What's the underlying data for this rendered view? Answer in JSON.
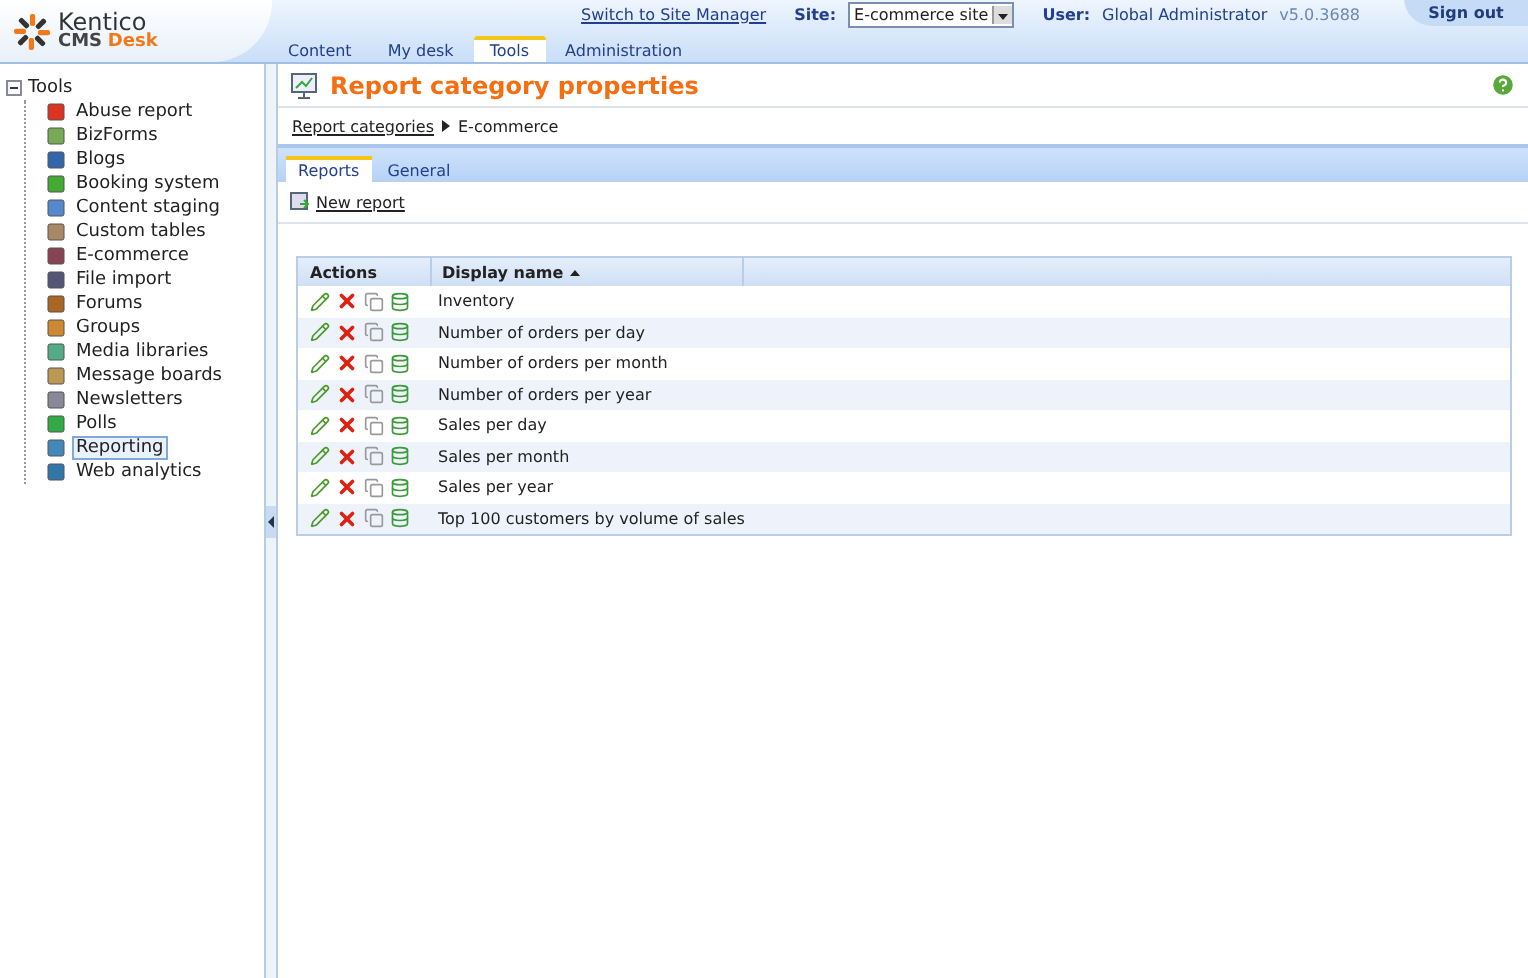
{
  "logo": {
    "name": "Kentico",
    "product": "CMS",
    "edition": "Desk"
  },
  "top_bar": {
    "site_manager_link": "Switch to Site Manager",
    "site_label": "Site:",
    "site_value": "E-commerce site",
    "user_label": "User:",
    "user_name": "Global Administrator",
    "version": "v5.0.3688",
    "sign_out": "Sign out"
  },
  "main_tabs": [
    {
      "label": "Content",
      "selected": false
    },
    {
      "label": "My desk",
      "selected": false
    },
    {
      "label": "Tools",
      "selected": true
    },
    {
      "label": "Administration",
      "selected": false
    }
  ],
  "sidebar": {
    "root": "Tools",
    "expanded": true,
    "items": [
      {
        "label": "Abuse report",
        "selected": false
      },
      {
        "label": "BizForms",
        "selected": false
      },
      {
        "label": "Blogs",
        "selected": false
      },
      {
        "label": "Booking system",
        "selected": false
      },
      {
        "label": "Content staging",
        "selected": false
      },
      {
        "label": "Custom tables",
        "selected": false
      },
      {
        "label": "E-commerce",
        "selected": false
      },
      {
        "label": "File import",
        "selected": false
      },
      {
        "label": "Forums",
        "selected": false
      },
      {
        "label": "Groups",
        "selected": false
      },
      {
        "label": "Media libraries",
        "selected": false
      },
      {
        "label": "Message boards",
        "selected": false
      },
      {
        "label": "Newsletters",
        "selected": false
      },
      {
        "label": "Polls",
        "selected": false
      },
      {
        "label": "Reporting",
        "selected": true
      },
      {
        "label": "Web analytics",
        "selected": false
      }
    ]
  },
  "page": {
    "title": "Report category properties",
    "breadcrumb": [
      "Report categories",
      "E-commerce"
    ]
  },
  "sub_tabs": [
    {
      "label": "Reports",
      "selected": true
    },
    {
      "label": "General",
      "selected": false
    }
  ],
  "new_report": "New report",
  "table": {
    "columns": [
      "Actions",
      "Display name"
    ],
    "rows": [
      "Inventory",
      "Number of orders per day",
      "Number of orders per month",
      "Number of orders per year",
      "Sales per day",
      "Sales per month",
      "Sales per year",
      "Top 100 customers by volume of sales"
    ]
  }
}
